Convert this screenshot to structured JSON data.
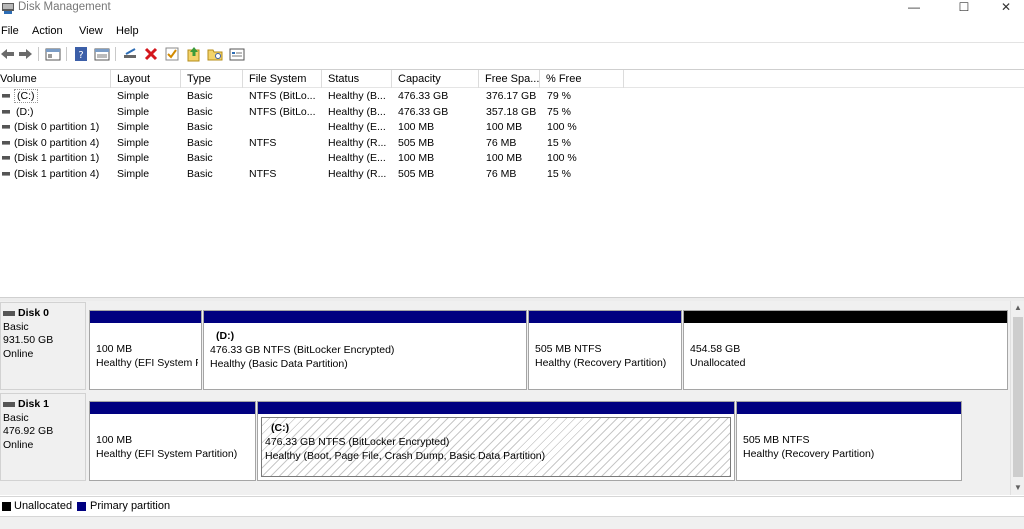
{
  "window": {
    "title": "Disk Management",
    "minimize_glyph": "—",
    "maximize_glyph": "☐",
    "close_glyph": "✕"
  },
  "menu": [
    "File",
    "Action",
    "View",
    "Help"
  ],
  "toolbar": {
    "buttons": [
      "back-arrow-icon",
      "forward-arrow-icon",
      "show-hide-console-tree-icon",
      "help-icon",
      "properties-icon",
      "connect-drive-icon",
      "delete-icon",
      "check-icon",
      "export-icon",
      "folder-icon",
      "console-icon"
    ]
  },
  "volume_list": {
    "columns": [
      "Volume",
      "Layout",
      "Type",
      "File System",
      "Status",
      "Capacity",
      "Free Spa...",
      "% Free"
    ],
    "rows": [
      [
        "(C:)",
        "Simple",
        "Basic",
        "NTFS (BitLo...",
        "Healthy (B...",
        "476.33 GB",
        "376.17 GB",
        "79 %"
      ],
      [
        "(D:)",
        "Simple",
        "Basic",
        "NTFS (BitLo...",
        "Healthy (B...",
        "476.33 GB",
        "357.18 GB",
        "75 %"
      ],
      [
        "(Disk 0 partition 1)",
        "Simple",
        "Basic",
        "",
        "Healthy (E...",
        "100 MB",
        "100 MB",
        "100 %"
      ],
      [
        "(Disk 0 partition 4)",
        "Simple",
        "Basic",
        "NTFS",
        "Healthy (R...",
        "505 MB",
        "76 MB",
        "15 %"
      ],
      [
        "(Disk 1 partition 1)",
        "Simple",
        "Basic",
        "",
        "Healthy (E...",
        "100 MB",
        "100 MB",
        "100 %"
      ],
      [
        "(Disk 1 partition 4)",
        "Simple",
        "Basic",
        "NTFS",
        "Healthy (R...",
        "505 MB",
        "76 MB",
        "15 %"
      ]
    ]
  },
  "disks": [
    {
      "name": "Disk 0",
      "type": "Basic",
      "size": "931.50 GB",
      "status": "Online",
      "partitions": [
        {
          "title": "",
          "line1": "100 MB",
          "line2": "Healthy (EFI System P"
        },
        {
          "title": "(D:)",
          "line1": "476.33 GB NTFS (BitLocker Encrypted)",
          "line2": "Healthy (Basic Data Partition)"
        },
        {
          "title": "",
          "line1": "505 MB NTFS",
          "line2": "Healthy (Recovery Partition)"
        },
        {
          "title": "",
          "line1": "454.58 GB",
          "line2": "Unallocated"
        }
      ]
    },
    {
      "name": "Disk 1",
      "type": "Basic",
      "size": "476.92 GB",
      "status": "Online",
      "partitions": [
        {
          "title": "",
          "line1": "100 MB",
          "line2": "Healthy (EFI System Partition)"
        },
        {
          "title": "(C:)",
          "line1": "476.33 GB NTFS (BitLocker Encrypted)",
          "line2": "Healthy (Boot, Page File, Crash Dump, Basic Data Partition)"
        },
        {
          "title": "",
          "line1": "505 MB NTFS",
          "line2": "Healthy (Recovery Partition)"
        }
      ]
    }
  ],
  "legend": [
    {
      "label": "Unallocated",
      "color": "#000000"
    },
    {
      "label": "Primary partition",
      "color": "#000080"
    }
  ],
  "colors": {
    "primary_partition": "#000080",
    "unallocated": "#000000"
  }
}
